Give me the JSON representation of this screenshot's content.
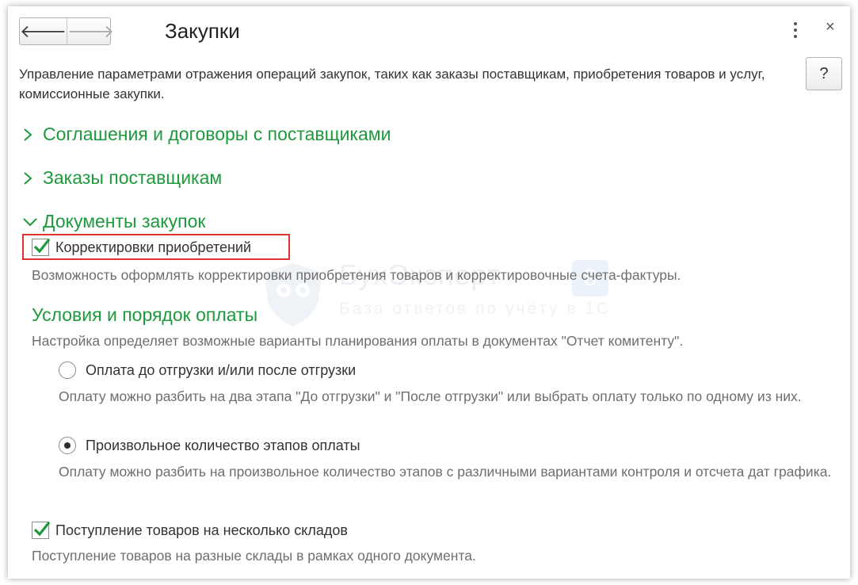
{
  "header": {
    "title": "Закупки",
    "back_glyph": "🡐",
    "forward_glyph": "🡒",
    "more_icon": "more-vertical-icon",
    "close_glyph": "×",
    "help_label": "?"
  },
  "description": "Управление параметрами отражения операций закупок, таких как заказы поставщикам, приобретения товаров и услуг, комиссионные закупки.",
  "groups": [
    {
      "label": "Соглашения и договоры с поставщиками",
      "expanded": false
    },
    {
      "label": "Заказы поставщикам",
      "expanded": false
    },
    {
      "label": "Документы закупок",
      "expanded": true
    }
  ],
  "purchase_docs": {
    "corrections": {
      "label": "Корректировки приобретений",
      "checked": true,
      "note": "Возможность оформлять корректировки приобретения товаров и корректировочные счета-фактуры."
    },
    "payment": {
      "title": "Условия и порядок оплаты",
      "note": "Настройка определяет возможные варианты планирования оплаты в документах \"Отчет комитенту\".",
      "options": [
        {
          "label": "Оплата до отгрузки и/или после отгрузки",
          "selected": false,
          "note": "Оплату можно разбить на два этапа \"До отгрузки\" и \"После отгрузки\" или выбрать оплату только по одному из них."
        },
        {
          "label": "Произвольное количество этапов оплаты",
          "selected": true,
          "note": "Оплату можно разбить на произвольное количество этапов с различными вариантами контроля и отсчета дат графика."
        }
      ]
    },
    "multi_warehouse": {
      "label": "Поступление товаров на несколько складов",
      "checked": true,
      "note": "Поступление товаров на разные склады в рамках одного документа."
    }
  },
  "watermark": {
    "title": "БухЭксперт",
    "badge": "8",
    "subtitle": "База ответов по учёту в 1С"
  },
  "colors": {
    "accent_green": "#1c9a3c",
    "highlight_red": "#e0322f",
    "note_gray": "#6e6e6e"
  }
}
